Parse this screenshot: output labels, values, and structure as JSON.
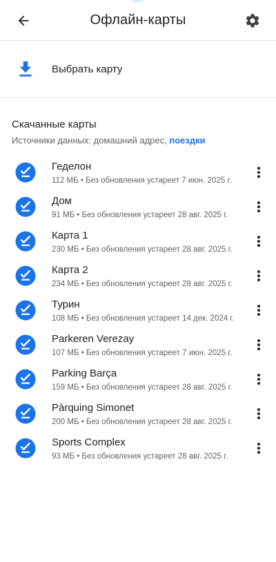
{
  "header": {
    "title": "Офлайн-карты",
    "back_icon": "arrow-left-icon",
    "settings_icon": "gear-icon"
  },
  "select_map": {
    "label": "Выбрать карту",
    "icon": "download-icon"
  },
  "downloaded": {
    "title": "Скачанные карты",
    "sources_prefix": "Источники данных: домашний адрес, ",
    "sources_link": "поездки"
  },
  "maps": [
    {
      "name": "Геделон",
      "meta": "112 МБ • Без обновления устареет 7 июн. 2025 г."
    },
    {
      "name": "Дом",
      "meta": "91 МБ • Без обновления устареет 28 авг. 2025 г."
    },
    {
      "name": "Карта 1",
      "meta": "230 МБ • Без обновления устареет 28 авг. 2025 г."
    },
    {
      "name": "Карта 2",
      "meta": "234 МБ • Без обновления устареет 28 авг. 2025 г."
    },
    {
      "name": "Турин",
      "meta": "108 МБ • Без обновления устареет 14 дек. 2024 г."
    },
    {
      "name": "Parkeren Verezay",
      "meta": "107 МБ • Без обновления устареет 7 июн. 2025 г."
    },
    {
      "name": "Parking Barça",
      "meta": "159 МБ • Без обновления устареет 28 авг. 2025 г."
    },
    {
      "name": "Pàrquing Simonet",
      "meta": "200 МБ • Без обновления устареет 28 авг. 2025 г."
    },
    {
      "name": "Sports Complex",
      "meta": "93 МБ • Без обновления устареет 28 авг. 2025 г."
    }
  ],
  "colors": {
    "accent": "#1a73e8",
    "text": "#202124",
    "secondary_text": "#5f6368",
    "divider": "#e3e3e3"
  }
}
